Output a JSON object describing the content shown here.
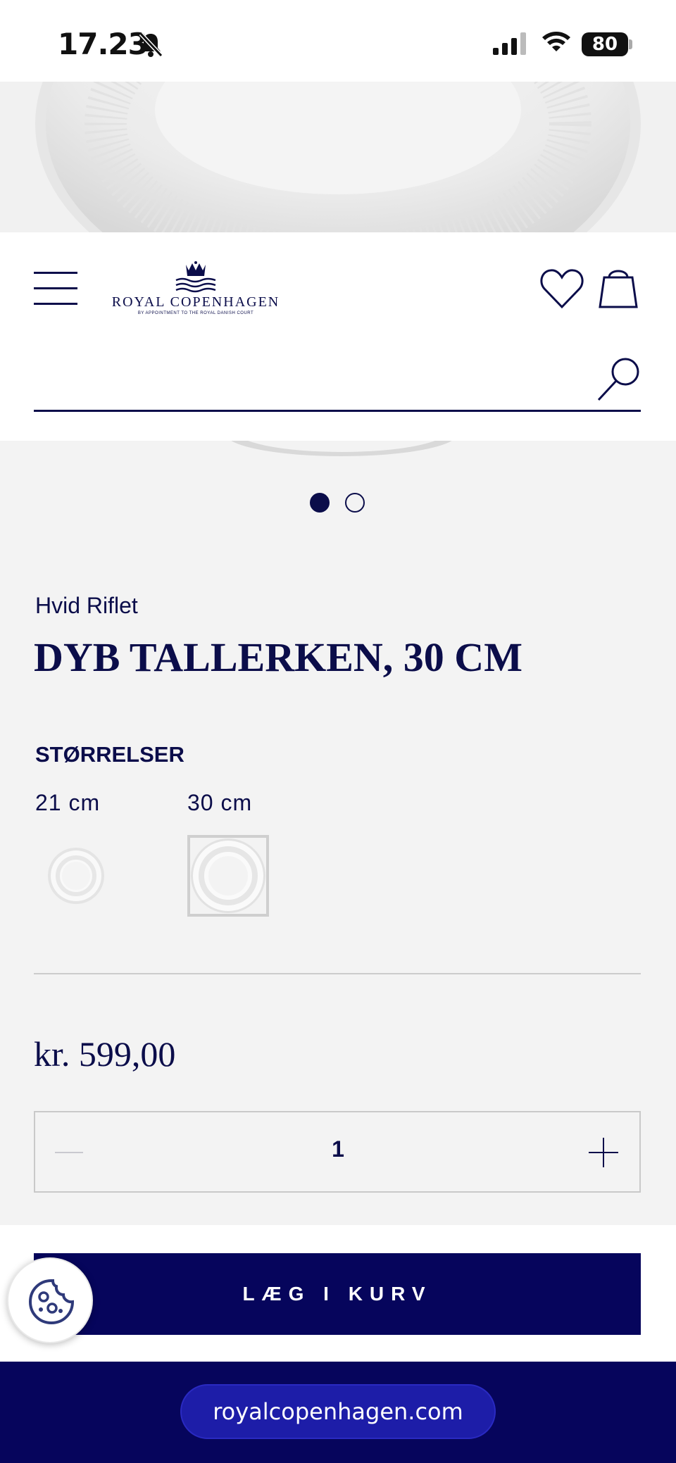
{
  "status_bar": {
    "time": "17.23",
    "battery": "80",
    "icons": [
      "bell-slash-icon",
      "signal-icon",
      "wifi-icon",
      "battery-icon"
    ]
  },
  "header": {
    "logo_text": "ROYAL COPENHAGEN",
    "logo_subtext": "BY APPOINTMENT TO THE ROYAL DANISH COURT",
    "search_placeholder": "",
    "search_value": "",
    "icons": [
      "menu-icon",
      "heart-icon",
      "shopping-bag-icon",
      "search-icon"
    ]
  },
  "carousel": {
    "total": 2,
    "active": 1
  },
  "product": {
    "collection": "Hvid Riflet",
    "title": "DYB TALLERKEN, 30 CM",
    "sizes_heading": "STØRRELSER",
    "sizes": [
      {
        "label": "21 cm",
        "selected": false
      },
      {
        "label": "30 cm",
        "selected": true
      }
    ],
    "price": "kr. 599,00",
    "quantity": "1",
    "add_to_cart_label": "LÆG I KURV"
  },
  "cookie_button": {
    "icon": "cookie-icon"
  },
  "browser": {
    "url": "royalcopenhagen.com"
  },
  "colors": {
    "brand_navy": "#06055c",
    "text_navy": "#0b0d4a",
    "background": "#f3f3f3"
  }
}
